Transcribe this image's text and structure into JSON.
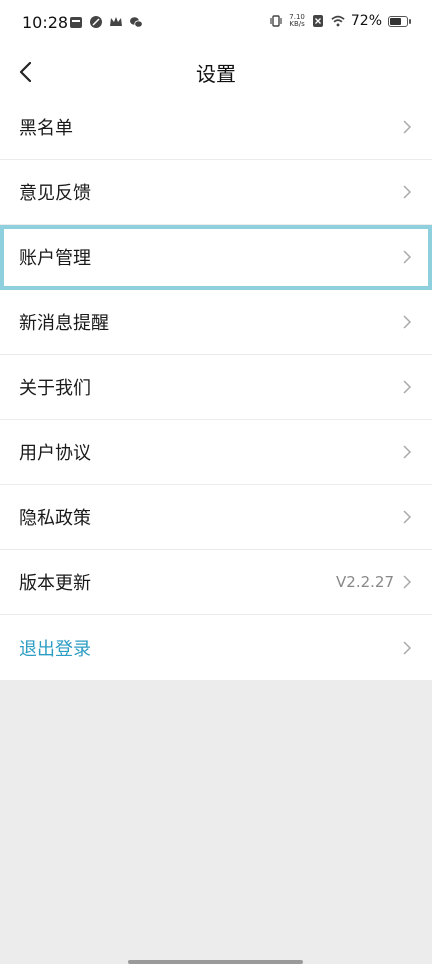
{
  "status": {
    "time": "10:28",
    "net_speed_value": "7.10",
    "net_speed_unit": "KB/s",
    "battery_percent": "72%",
    "battery_level": 0.72
  },
  "nav": {
    "title": "设置"
  },
  "settings": [
    {
      "label": "黑名单",
      "value": ""
    },
    {
      "label": "意见反馈",
      "value": ""
    },
    {
      "label": "账户管理",
      "value": ""
    },
    {
      "label": "新消息提醒",
      "value": ""
    },
    {
      "label": "关于我们",
      "value": ""
    },
    {
      "label": "用户协议",
      "value": ""
    },
    {
      "label": "隐私政策",
      "value": ""
    },
    {
      "label": "版本更新",
      "value": "V2.2.27"
    },
    {
      "label": "退出登录",
      "value": ""
    }
  ],
  "colors": {
    "logout": "#2d9dc3",
    "highlight": "#8fd0df",
    "background": "#ececec"
  }
}
